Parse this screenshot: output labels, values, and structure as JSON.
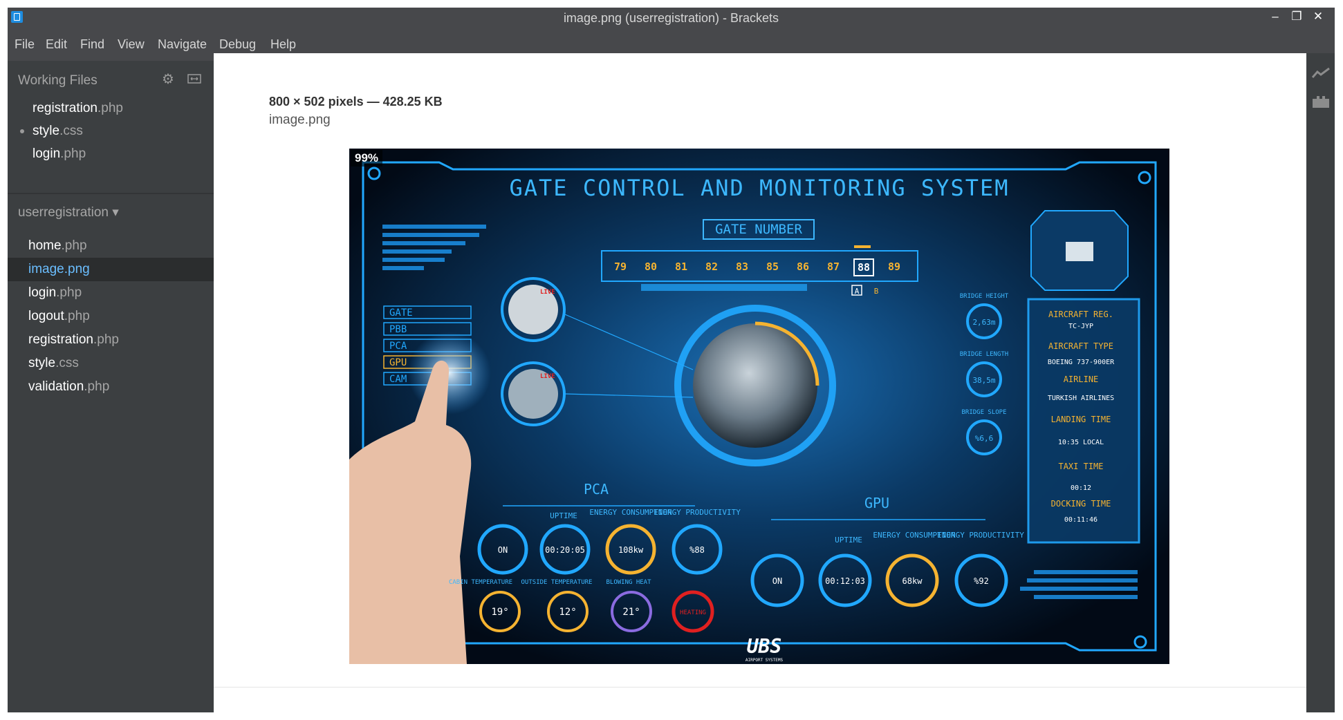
{
  "window": {
    "title": "image.png (userregistration) - Brackets",
    "controls": {
      "minimize": "–",
      "maximize": "❐",
      "close": "✕"
    }
  },
  "menu": [
    "File",
    "Edit",
    "Find",
    "View",
    "Navigate",
    "Debug",
    "Help"
  ],
  "working_files": {
    "header": "Working Files",
    "files": [
      {
        "name": "registration",
        "ext": ".php"
      },
      {
        "name": "style",
        "ext": ".css"
      },
      {
        "name": "login",
        "ext": ".php"
      }
    ]
  },
  "project": {
    "title": "userregistration ▾",
    "files": [
      {
        "name": "home",
        "ext": ".php"
      },
      {
        "name": "image",
        "ext": ".png"
      },
      {
        "name": "login",
        "ext": ".php"
      },
      {
        "name": "logout",
        "ext": ".php"
      },
      {
        "name": "registration",
        "ext": ".php"
      },
      {
        "name": "style",
        "ext": ".css"
      },
      {
        "name": "validation",
        "ext": ".php"
      }
    ]
  },
  "image_view": {
    "meta": "800 × 502 pixels — 428.25 KB",
    "filename": "image.png",
    "zoom": "99%"
  },
  "hud": {
    "title": "GATE CONTROL AND MONITORING SYSTEM",
    "gate_label": "GATE NUMBER",
    "gates": [
      "79",
      "80",
      "81",
      "82",
      "83",
      "85",
      "86",
      "87",
      "88",
      "89"
    ],
    "gate_selected": "88",
    "gate_suffix_a": "A",
    "gate_suffix_b": "B",
    "menu": [
      "GATE",
      "PBB",
      "PCA",
      "GPU",
      "CAM"
    ],
    "live": "LIVE",
    "bridge": [
      {
        "label": "BRIDGE HEIGHT",
        "value": "2,63m"
      },
      {
        "label": "BRIDGE LENGTH",
        "value": "38,5m"
      },
      {
        "label": "BRIDGE SLOPE",
        "value": "%6,6"
      }
    ],
    "info": [
      {
        "label": "AIRCRAFT REG.",
        "value": "TC-JYP"
      },
      {
        "label": "AIRCRAFT TYPE",
        "value": "BOEING 737-900ER"
      },
      {
        "label": "AIRLINE",
        "value": "TURKISH AIRLINES"
      },
      {
        "label": "LANDING TIME",
        "value": "10:35 LOCAL"
      },
      {
        "label": "TAXI TIME",
        "value": "00:12"
      },
      {
        "label": "DOCKING TIME",
        "value": "00:11:46"
      }
    ],
    "pca": {
      "title": "PCA",
      "labels": [
        "UPTIME",
        "ENERGY CONSUMPTION",
        "ENERGY PRODUCTIVITY"
      ],
      "gauges": [
        "ON",
        "00:20:05",
        "108kw",
        "%88"
      ],
      "temp_labels": [
        "CABIN TEMPERATURE",
        "OUTSIDE TEMPERATURE",
        "BLOWING HEAT"
      ],
      "temps": [
        "19°",
        "12°",
        "21°",
        "HEATING"
      ]
    },
    "gpu": {
      "title": "GPU",
      "labels": [
        "UPTIME",
        "ENERGY CONSUMPTION",
        "ENERGY PRODUCTIVITY"
      ],
      "gauges": [
        "ON",
        "00:12:03",
        "68kw",
        "%92"
      ]
    },
    "brand": "UBS",
    "brand_sub": "AIRPORT SYSTEMS"
  }
}
